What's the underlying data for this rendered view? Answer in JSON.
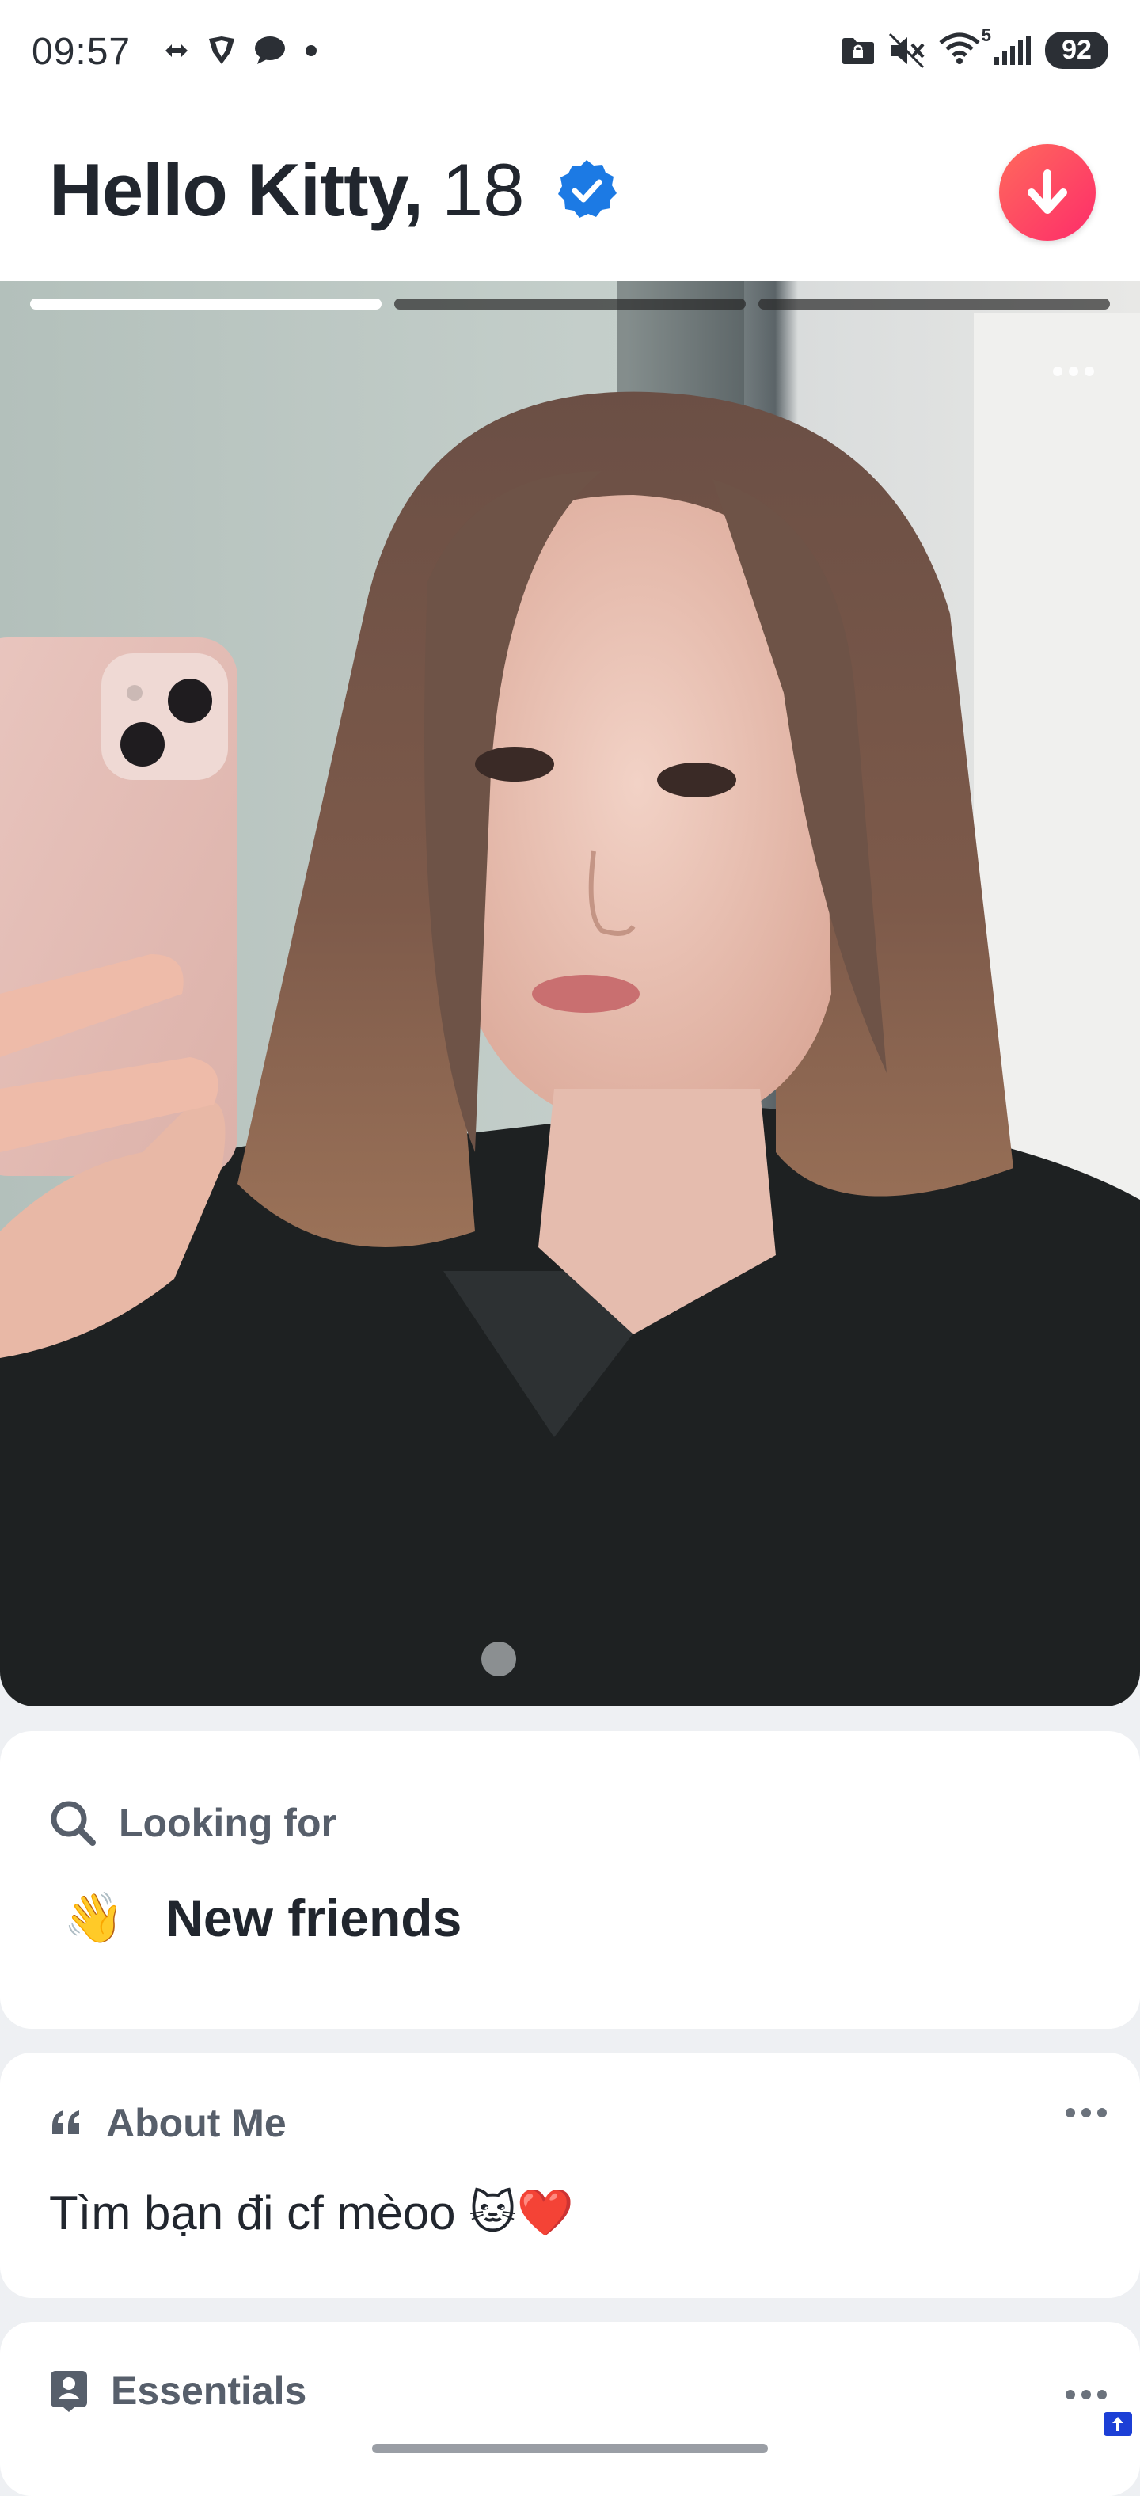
{
  "status_bar": {
    "time": "09:57",
    "battery": "92",
    "left_icons": [
      "transfer-icon",
      "shield-icon",
      "chat-icon",
      "dot-icon"
    ],
    "right_icons": [
      "lock-folder-icon",
      "mute-icon",
      "wifi-icon",
      "signal-icon"
    ],
    "wifi_badge": "5"
  },
  "profile": {
    "name": "Hello Kitty,",
    "age": "18",
    "verified": true,
    "accent_color": "#fd3a62",
    "verified_color": "#1c7ae4"
  },
  "photo": {
    "total_photos": 3,
    "current_photo": 1
  },
  "looking_for": {
    "heading": "Looking for",
    "emoji": "👋",
    "value": "New friends"
  },
  "about_me": {
    "heading": "About Me",
    "text": "Tìm bạn đi cf mèoo ",
    "emojis": "🐱❤️"
  },
  "essentials": {
    "heading": "Essentials"
  }
}
